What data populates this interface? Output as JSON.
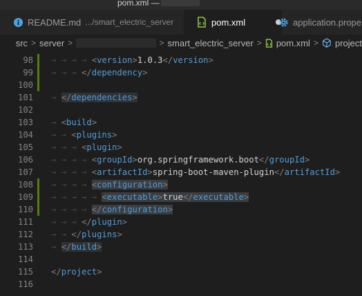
{
  "window": {
    "title": "pom.xml —"
  },
  "tabs": [
    {
      "label": "README.md",
      "desc": ".../smart_electric_server",
      "icon": "info-icon"
    },
    {
      "label": "pom.xml",
      "icon": "xml-file-icon",
      "dirty": true
    },
    {
      "label": "application.prope",
      "icon": "gear-icon"
    }
  ],
  "breadcrumb": {
    "items": [
      "src",
      "server",
      "smart_electric_server",
      "pom.xml",
      "project"
    ],
    "separator": ">"
  },
  "editor": {
    "lines": [
      {
        "num": "98",
        "text": "<version>1.0.3</version>"
      },
      {
        "num": "99",
        "text": "</dependency>"
      },
      {
        "num": "100",
        "text": ""
      },
      {
        "num": "101",
        "text": "</dependencies>"
      },
      {
        "num": "102",
        "text": ""
      },
      {
        "num": "103",
        "text": "<build>"
      },
      {
        "num": "104",
        "text": "<plugins>"
      },
      {
        "num": "105",
        "text": "<plugin>"
      },
      {
        "num": "106",
        "text": "<groupId>org.springframework.boot</groupId>"
      },
      {
        "num": "107",
        "text": "<artifactId>spring-boot-maven-plugin</artifactId>"
      },
      {
        "num": "108",
        "text": "<configuration>"
      },
      {
        "num": "109",
        "text": "<executable>true</executable>"
      },
      {
        "num": "110",
        "text": "</configuration>"
      },
      {
        "num": "111",
        "text": "</plugin>"
      },
      {
        "num": "112",
        "text": "</plugins>"
      },
      {
        "num": "113",
        "text": "</build>"
      },
      {
        "num": "114",
        "text": ""
      },
      {
        "num": "115",
        "text": "</project>"
      },
      {
        "num": "116",
        "text": ""
      }
    ]
  },
  "colors": {
    "tag": "#569cd6",
    "bracket": "#808080",
    "text": "#d4d4d4",
    "added_line": "#587c0c",
    "background": "#1e1e1e"
  }
}
